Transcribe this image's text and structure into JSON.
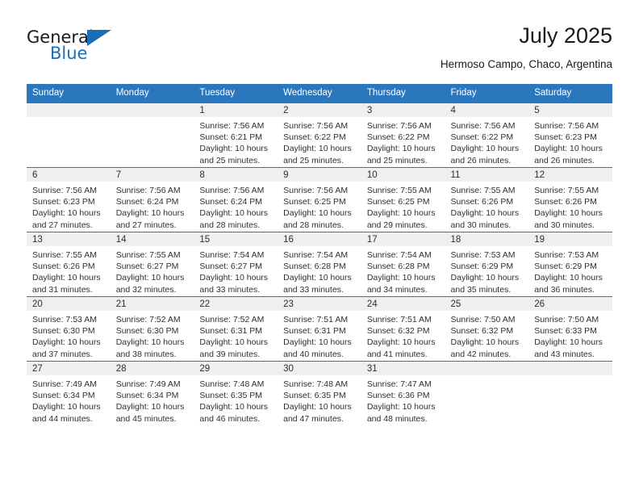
{
  "brand": {
    "name_top": "General",
    "name_bottom": "Blue",
    "accent_color": "#1a6fb4"
  },
  "header": {
    "title": "July 2025",
    "subtitle": "Hermoso Campo, Chaco, Argentina"
  },
  "calendar": {
    "header_color": "#2b77bd",
    "daynum_bg": "#efefef",
    "weekday_headers": [
      "Sunday",
      "Monday",
      "Tuesday",
      "Wednesday",
      "Thursday",
      "Friday",
      "Saturday"
    ],
    "weeks": [
      [
        {
          "day": ""
        },
        {
          "day": ""
        },
        {
          "day": "1",
          "sunrise": "Sunrise: 7:56 AM",
          "sunset": "Sunset: 6:21 PM",
          "daylight": "Daylight: 10 hours and 25 minutes."
        },
        {
          "day": "2",
          "sunrise": "Sunrise: 7:56 AM",
          "sunset": "Sunset: 6:22 PM",
          "daylight": "Daylight: 10 hours and 25 minutes."
        },
        {
          "day": "3",
          "sunrise": "Sunrise: 7:56 AM",
          "sunset": "Sunset: 6:22 PM",
          "daylight": "Daylight: 10 hours and 25 minutes."
        },
        {
          "day": "4",
          "sunrise": "Sunrise: 7:56 AM",
          "sunset": "Sunset: 6:22 PM",
          "daylight": "Daylight: 10 hours and 26 minutes."
        },
        {
          "day": "5",
          "sunrise": "Sunrise: 7:56 AM",
          "sunset": "Sunset: 6:23 PM",
          "daylight": "Daylight: 10 hours and 26 minutes."
        }
      ],
      [
        {
          "day": "6",
          "sunrise": "Sunrise: 7:56 AM",
          "sunset": "Sunset: 6:23 PM",
          "daylight": "Daylight: 10 hours and 27 minutes."
        },
        {
          "day": "7",
          "sunrise": "Sunrise: 7:56 AM",
          "sunset": "Sunset: 6:24 PM",
          "daylight": "Daylight: 10 hours and 27 minutes."
        },
        {
          "day": "8",
          "sunrise": "Sunrise: 7:56 AM",
          "sunset": "Sunset: 6:24 PM",
          "daylight": "Daylight: 10 hours and 28 minutes."
        },
        {
          "day": "9",
          "sunrise": "Sunrise: 7:56 AM",
          "sunset": "Sunset: 6:25 PM",
          "daylight": "Daylight: 10 hours and 28 minutes."
        },
        {
          "day": "10",
          "sunrise": "Sunrise: 7:55 AM",
          "sunset": "Sunset: 6:25 PM",
          "daylight": "Daylight: 10 hours and 29 minutes."
        },
        {
          "day": "11",
          "sunrise": "Sunrise: 7:55 AM",
          "sunset": "Sunset: 6:26 PM",
          "daylight": "Daylight: 10 hours and 30 minutes."
        },
        {
          "day": "12",
          "sunrise": "Sunrise: 7:55 AM",
          "sunset": "Sunset: 6:26 PM",
          "daylight": "Daylight: 10 hours and 30 minutes."
        }
      ],
      [
        {
          "day": "13",
          "sunrise": "Sunrise: 7:55 AM",
          "sunset": "Sunset: 6:26 PM",
          "daylight": "Daylight: 10 hours and 31 minutes."
        },
        {
          "day": "14",
          "sunrise": "Sunrise: 7:55 AM",
          "sunset": "Sunset: 6:27 PM",
          "daylight": "Daylight: 10 hours and 32 minutes."
        },
        {
          "day": "15",
          "sunrise": "Sunrise: 7:54 AM",
          "sunset": "Sunset: 6:27 PM",
          "daylight": "Daylight: 10 hours and 33 minutes."
        },
        {
          "day": "16",
          "sunrise": "Sunrise: 7:54 AM",
          "sunset": "Sunset: 6:28 PM",
          "daylight": "Daylight: 10 hours and 33 minutes."
        },
        {
          "day": "17",
          "sunrise": "Sunrise: 7:54 AM",
          "sunset": "Sunset: 6:28 PM",
          "daylight": "Daylight: 10 hours and 34 minutes."
        },
        {
          "day": "18",
          "sunrise": "Sunrise: 7:53 AM",
          "sunset": "Sunset: 6:29 PM",
          "daylight": "Daylight: 10 hours and 35 minutes."
        },
        {
          "day": "19",
          "sunrise": "Sunrise: 7:53 AM",
          "sunset": "Sunset: 6:29 PM",
          "daylight": "Daylight: 10 hours and 36 minutes."
        }
      ],
      [
        {
          "day": "20",
          "sunrise": "Sunrise: 7:53 AM",
          "sunset": "Sunset: 6:30 PM",
          "daylight": "Daylight: 10 hours and 37 minutes."
        },
        {
          "day": "21",
          "sunrise": "Sunrise: 7:52 AM",
          "sunset": "Sunset: 6:30 PM",
          "daylight": "Daylight: 10 hours and 38 minutes."
        },
        {
          "day": "22",
          "sunrise": "Sunrise: 7:52 AM",
          "sunset": "Sunset: 6:31 PM",
          "daylight": "Daylight: 10 hours and 39 minutes."
        },
        {
          "day": "23",
          "sunrise": "Sunrise: 7:51 AM",
          "sunset": "Sunset: 6:31 PM",
          "daylight": "Daylight: 10 hours and 40 minutes."
        },
        {
          "day": "24",
          "sunrise": "Sunrise: 7:51 AM",
          "sunset": "Sunset: 6:32 PM",
          "daylight": "Daylight: 10 hours and 41 minutes."
        },
        {
          "day": "25",
          "sunrise": "Sunrise: 7:50 AM",
          "sunset": "Sunset: 6:32 PM",
          "daylight": "Daylight: 10 hours and 42 minutes."
        },
        {
          "day": "26",
          "sunrise": "Sunrise: 7:50 AM",
          "sunset": "Sunset: 6:33 PM",
          "daylight": "Daylight: 10 hours and 43 minutes."
        }
      ],
      [
        {
          "day": "27",
          "sunrise": "Sunrise: 7:49 AM",
          "sunset": "Sunset: 6:34 PM",
          "daylight": "Daylight: 10 hours and 44 minutes."
        },
        {
          "day": "28",
          "sunrise": "Sunrise: 7:49 AM",
          "sunset": "Sunset: 6:34 PM",
          "daylight": "Daylight: 10 hours and 45 minutes."
        },
        {
          "day": "29",
          "sunrise": "Sunrise: 7:48 AM",
          "sunset": "Sunset: 6:35 PM",
          "daylight": "Daylight: 10 hours and 46 minutes."
        },
        {
          "day": "30",
          "sunrise": "Sunrise: 7:48 AM",
          "sunset": "Sunset: 6:35 PM",
          "daylight": "Daylight: 10 hours and 47 minutes."
        },
        {
          "day": "31",
          "sunrise": "Sunrise: 7:47 AM",
          "sunset": "Sunset: 6:36 PM",
          "daylight": "Daylight: 10 hours and 48 minutes."
        },
        {
          "day": ""
        },
        {
          "day": ""
        }
      ]
    ]
  }
}
